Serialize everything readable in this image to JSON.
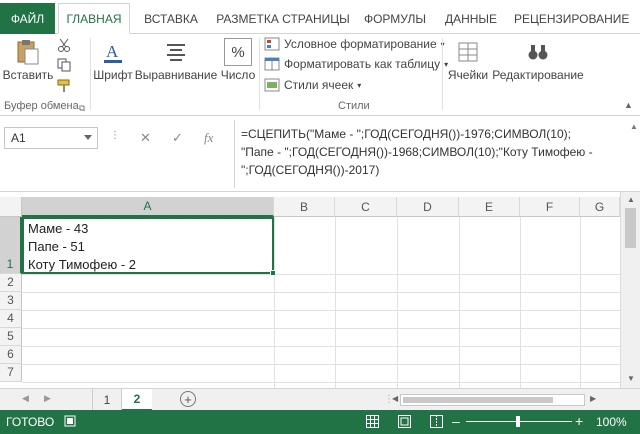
{
  "ribbon_tabs": [
    "ФАЙЛ",
    "ГЛАВНАЯ",
    "ВСТАВКА",
    "РАЗМЕТКА СТРАНИЦЫ",
    "ФОРМУЛЫ",
    "ДАННЫЕ",
    "РЕЦЕНЗИРОВАНИЕ"
  ],
  "ribbon": {
    "paste_label": "Вставить",
    "clipboard_group": "Буфер обмена",
    "font_label": "Шрифт",
    "alignment_label": "Выравнивание",
    "number_label": "Число",
    "number_icon_text": "%",
    "conditional_formatting": "Условное форматирование",
    "format_as_table": "Форматировать как таблицу",
    "cell_styles": "Стили ячеек",
    "styles_group": "Стили",
    "cells_label": "Ячейки",
    "editing_label": "Редактирование"
  },
  "formula_bar": {
    "name_box": "A1",
    "fx": "fx",
    "formula": "=СЦЕПИТЬ(\"Маме - \";ГОД(СЕГОДНЯ())-1976;СИМВОЛ(10);\n\"Папе - \";ГОД(СЕГОДНЯ())-1968;СИМВОЛ(10);\"Коту Тимофею -\n\";ГОД(СЕГОДНЯ())-2017)"
  },
  "grid": {
    "columns": [
      "A",
      "B",
      "C",
      "D",
      "E",
      "F",
      "G"
    ],
    "rows": [
      "1",
      "2",
      "3",
      "4",
      "5",
      "6",
      "7"
    ],
    "cell_a1": "Маме - 43\nПапе - 51\nКоту Тимофею - 2"
  },
  "sheets": {
    "tabs": [
      "1",
      "2"
    ],
    "active": "2"
  },
  "status_bar": {
    "ready": "ГОТОВО",
    "zoom": "100%"
  },
  "colors": {
    "accent": "#217346"
  }
}
